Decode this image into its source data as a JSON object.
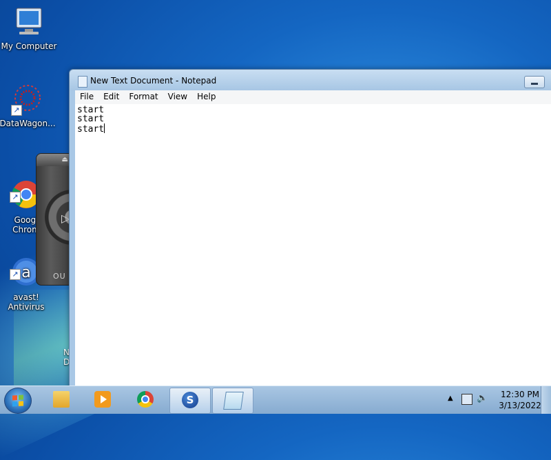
{
  "desktop": {
    "icons": [
      {
        "label": "My Computer",
        "icon": "computer-icon"
      },
      {
        "label": "DataWagon...",
        "icon": "datawagon-icon"
      },
      {
        "label": "Googl\nChrom",
        "icon": "chrome-icon"
      },
      {
        "label": "avast!\nAntivirus",
        "icon": "avast-icon"
      }
    ],
    "partial_label": "N\nD"
  },
  "notepad": {
    "title": "New Text Document - Notepad",
    "menu": [
      "File",
      "Edit",
      "Format",
      "View",
      "Help"
    ],
    "lines": [
      "start",
      "start",
      "start"
    ]
  },
  "widget": {
    "brand": "OU"
  },
  "taskbar": {
    "items": [
      {
        "icon": "windows-explorer-icon",
        "active": false
      },
      {
        "icon": "media-player-icon",
        "active": false
      },
      {
        "icon": "chrome-icon",
        "active": false
      },
      {
        "icon": "s-app-icon",
        "active": true
      },
      {
        "icon": "notepad-icon",
        "active": true
      }
    ],
    "clock": {
      "time": "12:30 PM",
      "date": "3/13/2022"
    }
  },
  "colors": {
    "desktop": "#1466c2",
    "titlebar": "#b7d2ec",
    "taskbar": "#97b8da"
  }
}
